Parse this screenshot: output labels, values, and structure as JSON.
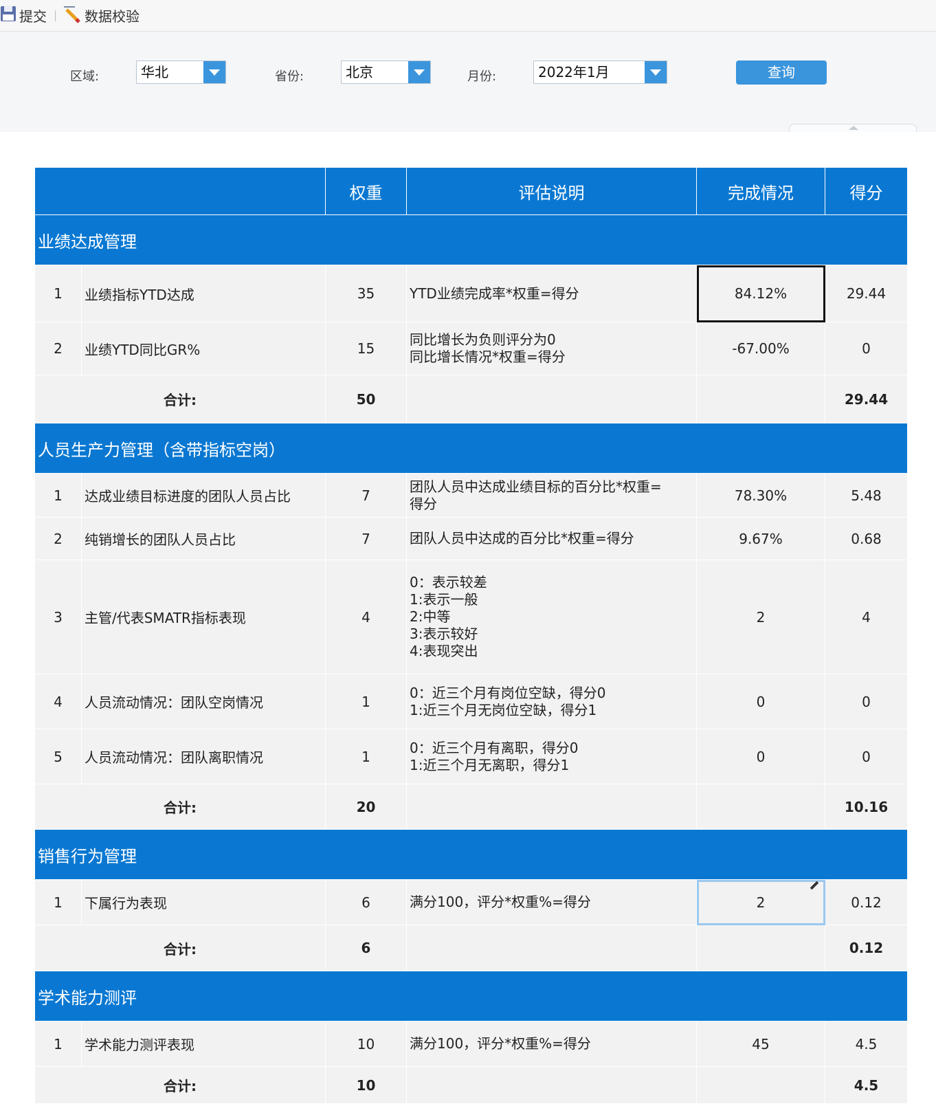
{
  "toolbar": {
    "submit_label": "提交",
    "validate_label": "数据校验"
  },
  "filters": {
    "region_label": "区域:",
    "region_value": "华北",
    "province_label": "省份:",
    "province_value": "北京",
    "month_label": "月份:",
    "month_value": "2022年1月",
    "query_label": "查询"
  },
  "table": {
    "headers": {
      "name": "",
      "weight": "权重",
      "desc": "评估说明",
      "completion": "完成情况",
      "score": "得分"
    },
    "total_label": "合计:",
    "sections": [
      {
        "title": "业绩达成管理",
        "rows": [
          {
            "no": "1",
            "name": "业绩指标YTD达成",
            "weight": "35",
            "desc": [
              "YTD业绩完成率*权重=得分"
            ],
            "completion": "84.12%",
            "score": "29.44"
          },
          {
            "no": "2",
            "name": "业绩YTD同比GR%",
            "weight": "15",
            "desc": [
              "同比增长为负则评分为0",
              "同比增长情况*权重=得分"
            ],
            "completion": "-67.00%",
            "score": "0"
          }
        ],
        "total_weight": "50",
        "total_score": "29.44"
      },
      {
        "title": "人员生产力管理（含带指标空岗）",
        "rows": [
          {
            "no": "1",
            "name": "达成业绩目标进度的团队人员占比",
            "weight": "7",
            "desc": [
              "团队人员中达成业绩目标的百分比*权重=",
              "得分"
            ],
            "completion": "78.30%",
            "score": "5.48"
          },
          {
            "no": "2",
            "name": "纯销增长的团队人员占比",
            "weight": "7",
            "desc": [
              "团队人员中达成的百分比*权重=得分"
            ],
            "completion": "9.67%",
            "score": "0.68"
          },
          {
            "no": "3",
            "name": "主管/代表SMATR指标表现",
            "weight": "4",
            "desc": [
              "0：表示较差",
              "1:表示一般",
              "2:中等",
              "3:表示较好",
              "4:表现突出"
            ],
            "completion": "2",
            "score": "4"
          },
          {
            "no": "4",
            "name": "人员流动情况：团队空岗情况",
            "weight": "1",
            "desc": [
              "0：近三个月有岗位空缺，得分0",
              "1:近三个月无岗位空缺，得分1"
            ],
            "completion": "0",
            "score": "0"
          },
          {
            "no": "5",
            "name": "人员流动情况：团队离职情况",
            "weight": "1",
            "desc": [
              "0：近三个月有离职，得分0",
              "1:近三个月无离职，得分1"
            ],
            "completion": "0",
            "score": "0"
          }
        ],
        "total_weight": "20",
        "total_score": "10.16"
      },
      {
        "title": "销售行为管理",
        "rows": [
          {
            "no": "1",
            "name": "下属行为表现",
            "weight": "6",
            "desc": [
              "满分100，评分*权重%=得分"
            ],
            "completion": "2",
            "score": "0.12"
          }
        ],
        "total_weight": "6",
        "total_score": "0.12"
      },
      {
        "title": "学术能力测评",
        "rows": [
          {
            "no": "1",
            "name": "学术能力测评表现",
            "weight": "10",
            "desc": [
              "满分100，评分*权重%=得分"
            ],
            "completion": "45",
            "score": "4.5"
          }
        ],
        "total_weight": "10",
        "total_score": "4.5"
      }
    ]
  }
}
